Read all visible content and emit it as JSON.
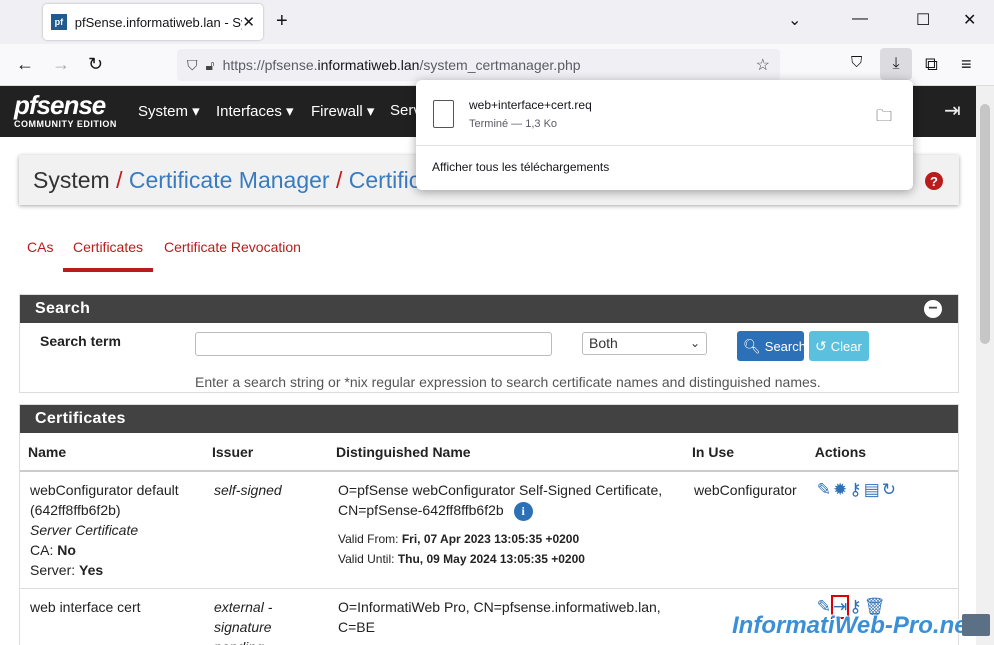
{
  "browser": {
    "tab_title": "pfSense.informatiweb.lan - Syst",
    "tab_favicon": "pf",
    "url_prefix": "https://pfsense.",
    "url_domain": "informatiweb.lan",
    "url_path": "/system_certmanager.php"
  },
  "downloads": {
    "file_name": "web+interface+cert.req",
    "status": "Terminé — 1,3 Ko",
    "show_all": "Afficher tous les téléchargements"
  },
  "header": {
    "logo_main": "pfsense",
    "logo_sub": "COMMUNITY EDITION",
    "menu": [
      "System ▾",
      "Interfaces ▾",
      "Firewall ▾",
      "Serv"
    ]
  },
  "breadcrumb": {
    "root": "System",
    "sep": "/",
    "level1": "Certificate Manager",
    "level2": "Certific"
  },
  "tabs": [
    "CAs",
    "Certificates",
    "Certificate Revocation"
  ],
  "search": {
    "title": "Search",
    "label": "Search term",
    "value": "",
    "scope": "Both",
    "search_btn": "Search",
    "clear_btn": "Clear",
    "hint": "Enter a search string or *nix regular expression to search certificate names and distinguished names."
  },
  "certs": {
    "title": "Certificates",
    "columns": [
      "Name",
      "Issuer",
      "Distinguished Name",
      "In Use",
      "Actions"
    ],
    "rows": [
      {
        "name1": "webConfigurator default",
        "name2": "(642ff8ffb6f2b)",
        "type": "Server Certificate",
        "ca_label": "CA:",
        "ca_val": "No",
        "server_label": "Server:",
        "server_val": "Yes",
        "issuer": "self-signed",
        "dn1": "O=pfSense webConfigurator Self-Signed Certificate,",
        "dn2": "CN=pfSense-642ff8ffb6f2b",
        "valid_from_label": "Valid From:",
        "valid_from": "Fri, 07 Apr 2023 13:05:35 +0200",
        "valid_until_label": "Valid Until:",
        "valid_until": "Thu, 09 May 2024 13:05:35 +0200",
        "in_use": "webConfigurator",
        "actions": [
          "pencil-icon",
          "gear-cert-icon",
          "key-icon",
          "archive-icon",
          "renew-icon"
        ]
      },
      {
        "name1": "web interface cert",
        "issuer1": "external -",
        "issuer2": "signature pending",
        "dn1": "O=InformatiWeb Pro, CN=pfsense.informatiweb.lan,",
        "dn2": "C=BE",
        "actions": [
          "pencil-icon",
          "import-icon",
          "key-icon",
          "trash-icon"
        ]
      }
    ]
  },
  "watermark": "InformatiWeb-Pro.net",
  "colors": {
    "accent_red": "#b81c1c",
    "link_blue": "#3a7bbf",
    "panel_head": "#424242"
  }
}
